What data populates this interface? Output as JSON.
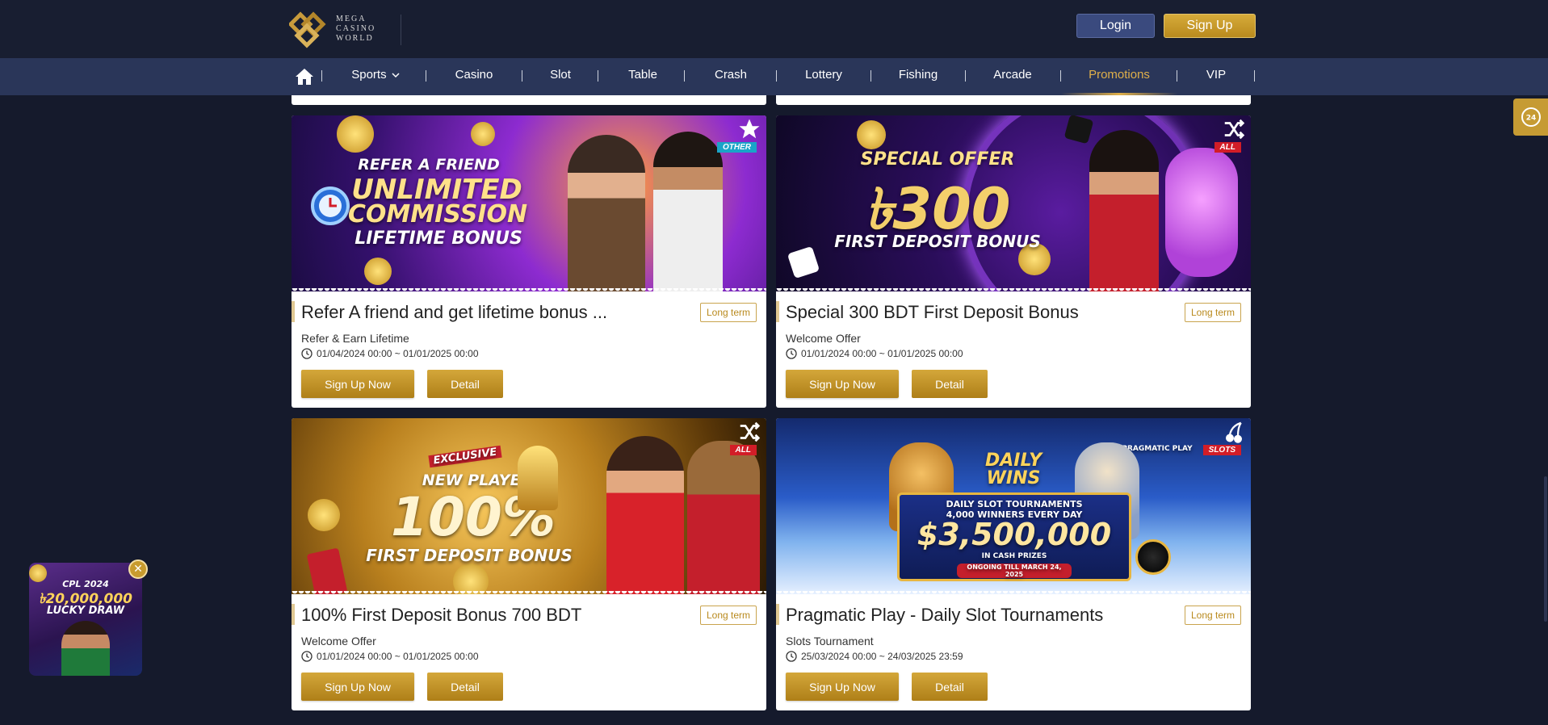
{
  "brand": {
    "line1": "MEGA",
    "line2": "CASINO",
    "line3": "WORLD"
  },
  "header": {
    "login": "Login",
    "signup": "Sign Up"
  },
  "nav": {
    "items": [
      "Sports",
      "Casino",
      "Slot",
      "Table",
      "Crash",
      "Lottery",
      "Fishing",
      "Arcade",
      "Promotions",
      "VIP"
    ],
    "active": "Promotions"
  },
  "colors": {
    "background": "#151a2c",
    "navbar": "#2a3659",
    "gold": "#c69b33",
    "login": "#3a4a7e"
  },
  "icons": [
    "home-icon",
    "chevron-down-icon",
    "star-icon",
    "shuffle-icon",
    "cherry-icon",
    "clock-icon",
    "support-24h-icon",
    "close-icon"
  ],
  "promotions": [
    {
      "title": "Refer A friend and get lifetime bonus ...",
      "term": "Long term",
      "category": "Refer & Earn Lifetime",
      "date": "01/04/2024 00:00 ~ 01/01/2025 00:00",
      "primary": "Sign Up Now",
      "detail": "Detail",
      "tag": "OTHER",
      "banner": {
        "l1": "REFER A FRIEND",
        "l2": "UNLIMITED",
        "l3": "COMMISSION",
        "l4": "LIFETIME BONUS"
      }
    },
    {
      "title": "Special 300 BDT First Deposit Bonus",
      "term": "Long term",
      "category": "Welcome Offer",
      "date": "01/01/2024 00:00 ~ 01/01/2025 00:00",
      "primary": "Sign Up Now",
      "detail": "Detail",
      "tag": "ALL",
      "banner": {
        "l1": "SPECIAL OFFER",
        "l2": "৳300",
        "l3": "FIRST DEPOSIT BONUS"
      }
    },
    {
      "title": "100% First Deposit Bonus 700 BDT",
      "term": "Long term",
      "category": "Welcome Offer",
      "date": "01/01/2024 00:00 ~ 01/01/2025 00:00",
      "primary": "Sign Up Now",
      "detail": "Detail",
      "tag": "ALL",
      "banner": {
        "l0": "EXCLUSIVE",
        "l1": "NEW PLAYER",
        "l2": "100%",
        "l3": "FIRST DEPOSIT BONUS"
      }
    },
    {
      "title": "Pragmatic Play - Daily Slot Tournaments",
      "term": "Long term",
      "category": "Slots Tournament",
      "date": "25/03/2024 00:00 ~ 24/03/2025 23:59",
      "primary": "Sign Up Now",
      "detail": "Detail",
      "tag": "SLOTS",
      "banner": {
        "l0": "PRAGMATIC PLAY",
        "l1": "DAILY",
        "l2": "WINS",
        "l3": "DAILY SLOT TOURNAMENTS",
        "l4": "4,000 WINNERS EVERY DAY",
        "l5": "$3,500,000",
        "l6": "IN CASH PRIZES",
        "l7": "ONGOING TILL MARCH 24, 2025"
      }
    }
  ],
  "popup": {
    "l1": "CPL 2024",
    "l2": "৳20,000,000",
    "l3": "LUCKY DRAW"
  }
}
